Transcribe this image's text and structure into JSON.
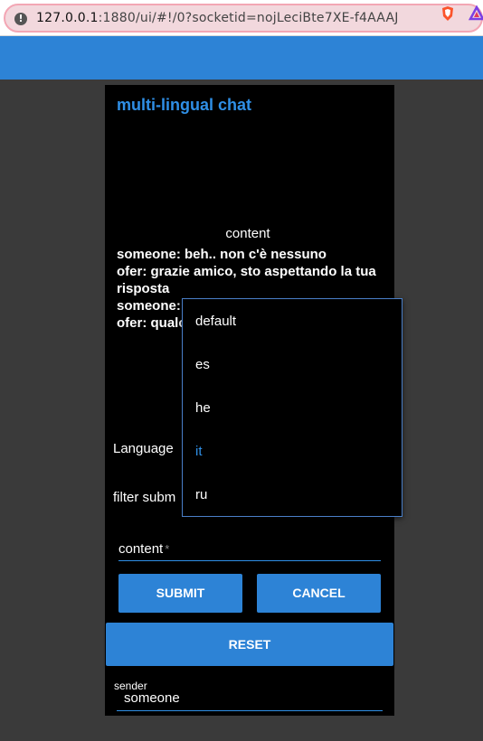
{
  "browser": {
    "info_glyph": "!",
    "url_host": "127.0.0.1",
    "url_rest": ":1880/ui/#!/0?socketid=nojLeciBte7XE-f4AAAJ"
  },
  "app": {
    "title": "multi-lingual chat",
    "content_label": "content",
    "messages": [
      "someone: beh.. non c'è nessuno",
      "ofer: grazie amico, sto aspettando la tua risposta",
      "someone:",
      "ofer: qualc"
    ],
    "language_label": "Language",
    "filter_label": "filter subm",
    "content_field_label": "content",
    "content_field_required": "*",
    "submit_label": "SUBMIT",
    "cancel_label": "CANCEL",
    "reset_label": "RESET",
    "sender_label": "sender",
    "sender_value": "someone"
  },
  "language_dropdown": {
    "options": [
      "default",
      "es",
      "he",
      "it",
      "ru"
    ],
    "selected": "it"
  },
  "colors": {
    "accent": "#2d83d6",
    "title": "#2f8fe6",
    "background": "#3a3a3a",
    "card": "#000000"
  }
}
